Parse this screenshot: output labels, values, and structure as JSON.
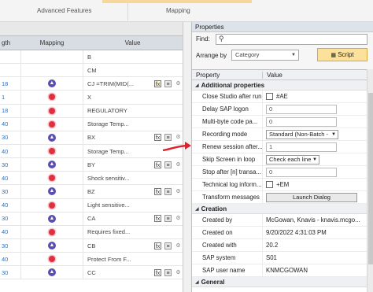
{
  "ribbon": {
    "tabs": [
      "Advanced Features",
      "Mapping"
    ]
  },
  "grid": {
    "headers": [
      "gth",
      "Mapping",
      "Value"
    ],
    "rows": [
      {
        "left": "",
        "icon": "none",
        "value": "B",
        "tools": false
      },
      {
        "left": "",
        "icon": "none",
        "value": "CM",
        "tools": false
      },
      {
        "left": "18",
        "icon": "up",
        "value": "CJ =TRIM(MID(...",
        "tools": true,
        "fx_active": true
      },
      {
        "left": "1",
        "icon": "pin",
        "value": "X",
        "tools": false
      },
      {
        "left": "18",
        "icon": "pin",
        "value": "REGULATORY",
        "tools": false
      },
      {
        "left": "40",
        "icon": "pin",
        "value": "Storage Temp...",
        "tools": false
      },
      {
        "left": "30",
        "icon": "up",
        "value": "BX",
        "tools": true
      },
      {
        "left": "40",
        "icon": "pin",
        "value": "Storage Temp...",
        "tools": false
      },
      {
        "left": "30",
        "icon": "up",
        "value": "BY",
        "tools": true
      },
      {
        "left": "40",
        "icon": "pin",
        "value": "Shock sensitiv...",
        "tools": false
      },
      {
        "left": "30",
        "icon": "up",
        "value": "BZ",
        "tools": true
      },
      {
        "left": "40",
        "icon": "pin",
        "value": "Light sensitive...",
        "tools": false
      },
      {
        "left": "30",
        "icon": "up",
        "value": "CA",
        "tools": true
      },
      {
        "left": "40",
        "icon": "pin",
        "value": "Requires fixed...",
        "tools": false
      },
      {
        "left": "30",
        "icon": "up",
        "value": "CB",
        "tools": true
      },
      {
        "left": "40",
        "icon": "pin",
        "value": "Protect From F...",
        "tools": false
      },
      {
        "left": "30",
        "icon": "up",
        "value": "CC",
        "tools": true
      }
    ]
  },
  "props": {
    "title": "Properties",
    "find_label": "Find:",
    "arrange_label": "Arrange by",
    "arrange_value": "Category",
    "script_label": "Script",
    "col_property": "Property",
    "col_value": "Value",
    "sec_additional": "Additional properties",
    "close_studio": {
      "name": "Close Studio after run",
      "value": "#AE"
    },
    "delay": {
      "name": "Delay SAP logon",
      "value": "0"
    },
    "multibyte": {
      "name": "Multi-byte code pa...",
      "value": "0"
    },
    "recording": {
      "name": "Recording mode",
      "value": "Standard (Non-Batch -"
    },
    "renew": {
      "name": "Renew session after...",
      "value": "1"
    },
    "skip": {
      "name": "Skip Screen in loop",
      "value": "Check each line"
    },
    "stop": {
      "name": "Stop after [n] transa...",
      "value": "0"
    },
    "techlog": {
      "name": "Technical log inform...",
      "value": "+EM"
    },
    "transform": {
      "name": "Transform messages",
      "value": "Launch Dialog"
    },
    "sec_creation": "Creation",
    "created_by": {
      "name": "Created by",
      "value": "McGowan, Knavis - knavis.mcgo..."
    },
    "created_on": {
      "name": "Created on",
      "value": "9/20/2022 4:31:03 PM"
    },
    "created_with": {
      "name": "Created with",
      "value": "20.2"
    },
    "sap_system": {
      "name": "SAP system",
      "value": "S01"
    },
    "sap_user": {
      "name": "SAP user name",
      "value": "KNMCGOWAN"
    },
    "sec_general": "General"
  },
  "colors": {
    "accent": "#fbe19a",
    "annotation": "#e0202a"
  }
}
